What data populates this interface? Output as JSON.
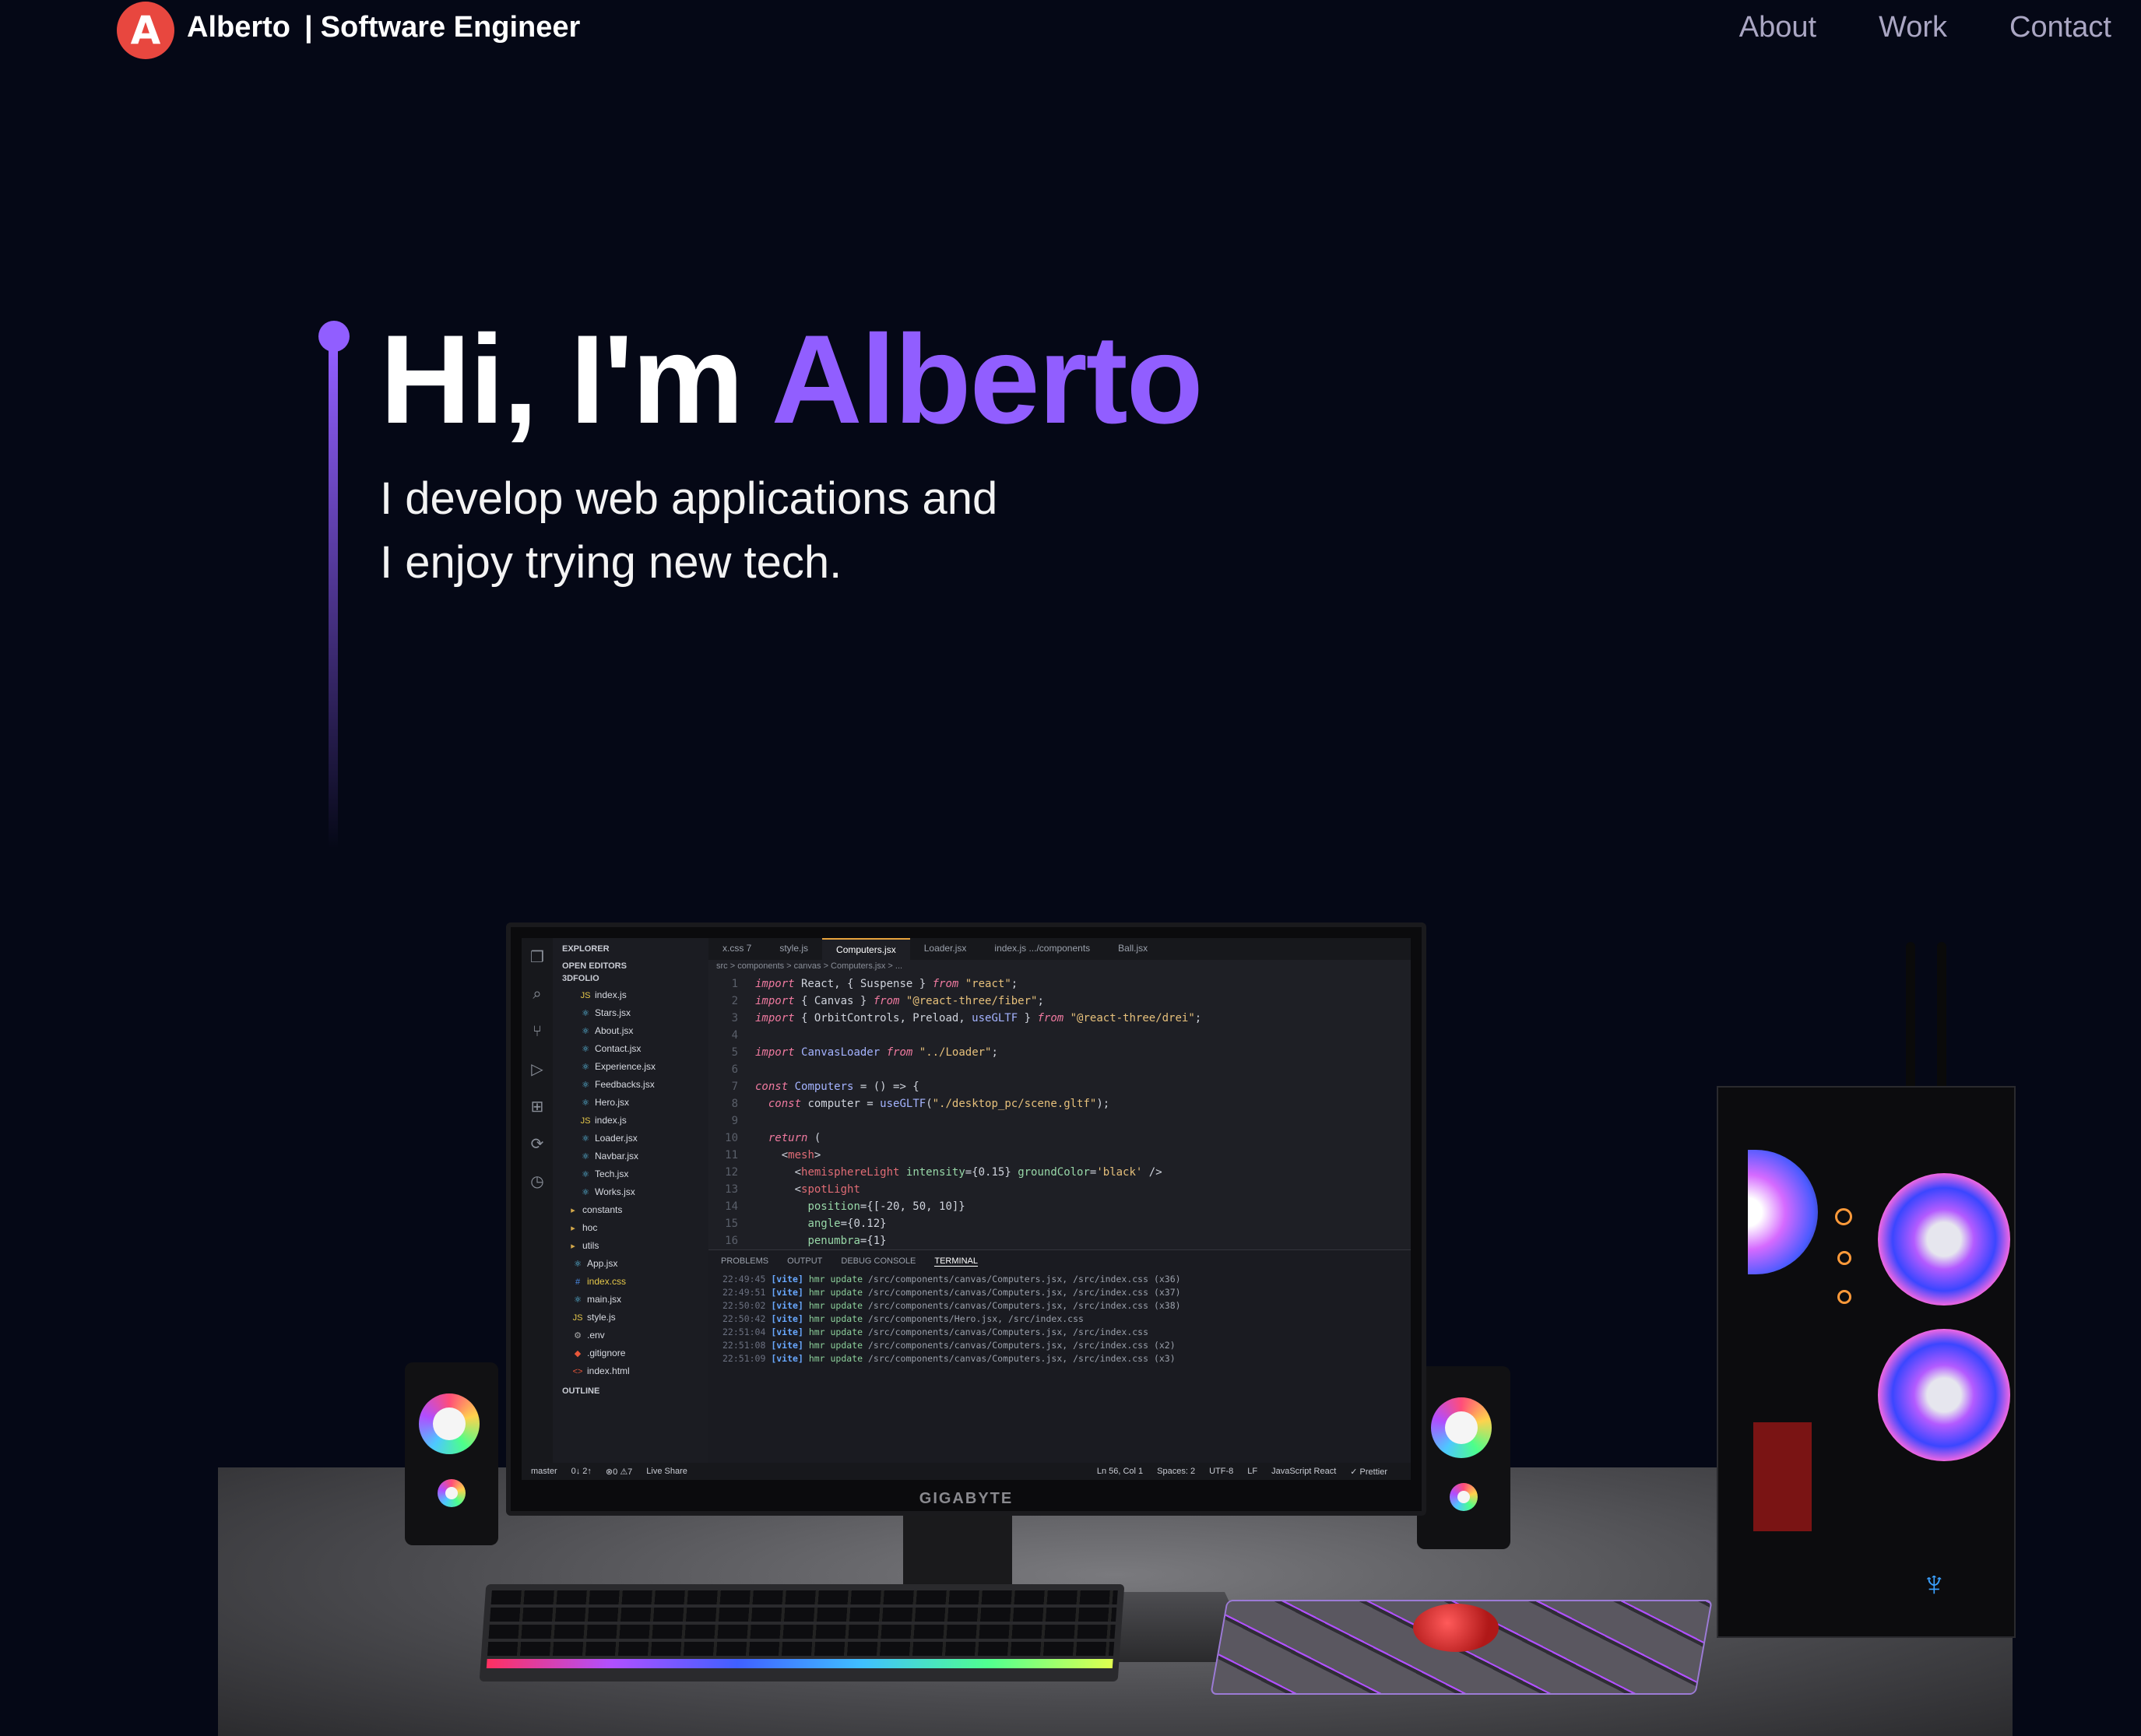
{
  "navbar": {
    "logo_letter": "A",
    "brand_name": "Alberto",
    "brand_separator": "|",
    "brand_role": "Software Engineer",
    "links": [
      "About",
      "Work",
      "Contact"
    ]
  },
  "hero": {
    "greeting": "Hi, I'm",
    "name": "Alberto",
    "subtitle_line1": "I develop web applications and",
    "subtitle_line2": "I enjoy trying new tech."
  },
  "colors": {
    "background": "#050816",
    "accent": "#915eff",
    "nav_link": "#aaa6c3"
  },
  "scene": {
    "monitor_brand": "GIGABYTE",
    "vscode": {
      "explorer_title": "EXPLORER",
      "open_editors": "OPEN EDITORS",
      "project": "3DFOLIO",
      "outline": "OUTLINE",
      "tree": [
        {
          "icon": "js",
          "name": "index.js"
        },
        {
          "icon": "react",
          "name": "Stars.jsx"
        },
        {
          "icon": "react",
          "name": "About.jsx"
        },
        {
          "icon": "react",
          "name": "Contact.jsx"
        },
        {
          "icon": "react",
          "name": "Experience.jsx"
        },
        {
          "icon": "react",
          "name": "Feedbacks.jsx"
        },
        {
          "icon": "react",
          "name": "Hero.jsx"
        },
        {
          "icon": "js",
          "name": "index.js"
        },
        {
          "icon": "react",
          "name": "Loader.jsx"
        },
        {
          "icon": "react",
          "name": "Navbar.jsx"
        },
        {
          "icon": "react",
          "name": "Tech.jsx"
        },
        {
          "icon": "react",
          "name": "Works.jsx"
        },
        {
          "icon": "folder",
          "name": "constants"
        },
        {
          "icon": "folder",
          "name": "hoc"
        },
        {
          "icon": "folder",
          "name": "utils"
        },
        {
          "icon": "react",
          "name": "App.jsx"
        },
        {
          "icon": "css",
          "name": "index.css"
        },
        {
          "icon": "react",
          "name": "main.jsx"
        },
        {
          "icon": "js",
          "name": "style.js"
        },
        {
          "icon": "gear",
          "name": ".env"
        },
        {
          "icon": "git",
          "name": ".gitignore"
        },
        {
          "icon": "html",
          "name": "index.html"
        }
      ],
      "tabs": [
        "x.css 7",
        "style.js",
        "Computers.jsx",
        "Loader.jsx",
        "index.js .../components",
        "Ball.jsx"
      ],
      "breadcrumb": "src > components > canvas > Computers.jsx > ...",
      "code": [
        {
          "ln": "1",
          "text": "import React, { Suspense } from \"react\";"
        },
        {
          "ln": "2",
          "text": "import { Canvas } from \"@react-three/fiber\";"
        },
        {
          "ln": "3",
          "text": "import { OrbitControls, Preload, useGLTF } from \"@react-three/drei\";"
        },
        {
          "ln": "4",
          "text": ""
        },
        {
          "ln": "5",
          "text": "import CanvasLoader from \"../Loader\";"
        },
        {
          "ln": "6",
          "text": ""
        },
        {
          "ln": "7",
          "text": "const Computers = () => {"
        },
        {
          "ln": "8",
          "text": "  const computer = useGLTF(\"./desktop_pc/scene.gltf\");"
        },
        {
          "ln": "9",
          "text": ""
        },
        {
          "ln": "10",
          "text": "  return ("
        },
        {
          "ln": "11",
          "text": "    <mesh>"
        },
        {
          "ln": "12",
          "text": "      <hemisphereLight intensity={0.15} groundColor='black' />"
        },
        {
          "ln": "13",
          "text": "      <spotLight"
        },
        {
          "ln": "14",
          "text": "        position={[-20, 50, 10]}"
        },
        {
          "ln": "15",
          "text": "        angle={0.12}"
        },
        {
          "ln": "16",
          "text": "        penumbra={1}"
        }
      ],
      "panel_tabs": [
        "PROBLEMS",
        "OUTPUT",
        "DEBUG CONSOLE",
        "TERMINAL"
      ],
      "terminal": [
        {
          "time": "22:49:45",
          "msg": "/src/components/canvas/Computers.jsx, /src/index.css (x36)"
        },
        {
          "time": "22:49:51",
          "msg": "/src/components/canvas/Computers.jsx, /src/index.css (x37)"
        },
        {
          "time": "22:50:02",
          "msg": "/src/components/canvas/Computers.jsx, /src/index.css (x38)"
        },
        {
          "time": "22:50:42",
          "msg": "/src/components/Hero.jsx, /src/index.css"
        },
        {
          "time": "22:51:04",
          "msg": "/src/components/canvas/Computers.jsx, /src/index.css"
        },
        {
          "time": "22:51:08",
          "msg": "/src/components/canvas/Computers.jsx, /src/index.css (x2)"
        },
        {
          "time": "22:51:09",
          "msg": "/src/components/canvas/Computers.jsx, /src/index.css (x3)"
        }
      ],
      "status_left": [
        "master",
        "0↓ 2↑",
        "⊗0 ⚠7",
        "Live Share"
      ],
      "status_right": [
        "Ln 56, Col 1",
        "Spaces: 2",
        "UTF-8",
        "LF",
        "JavaScript React",
        "✓ Prettier"
      ]
    },
    "icons": [
      "monitor-icon",
      "keyboard-icon",
      "mouse-icon",
      "speaker-icon",
      "pc-tower-icon"
    ]
  }
}
